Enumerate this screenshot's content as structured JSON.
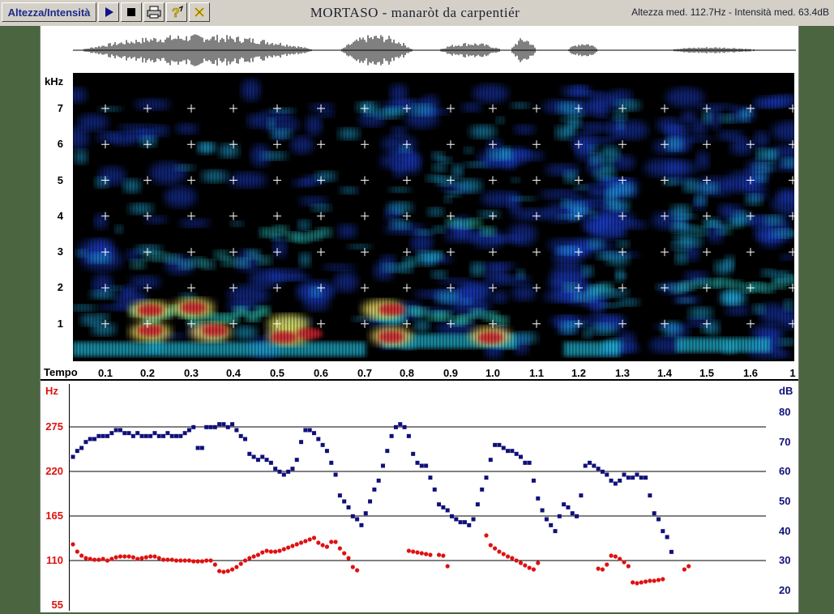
{
  "toolbar": {
    "mode_button": "Altezza/Intensità",
    "icons": [
      "play-icon",
      "stop-icon",
      "print-icon",
      "help-icon",
      "close-icon"
    ]
  },
  "title": "MORTASO  -  manaròt da carpentiér",
  "stats": "Altezza med. 112.7Hz - Intensità med. 63.4dB",
  "spectrogram": {
    "y_unit": "kHz",
    "y_ticks": [
      "7",
      "6",
      "5",
      "4",
      "3",
      "2",
      "1"
    ],
    "x_label": "Tempo",
    "x_ticks": [
      "0.1",
      "0.2",
      "0.3",
      "0.4",
      "0.5",
      "0.6",
      "0.7",
      "0.8",
      "0.9",
      "1.0",
      "1.1",
      "1.2",
      "1.3",
      "1.4",
      "1.5",
      "1.6",
      "1"
    ]
  },
  "pitch_plot": {
    "left_unit": "Hz",
    "left_ticks": [
      "275",
      "220",
      "165",
      "110",
      "55"
    ],
    "right_unit": "dB",
    "right_ticks": [
      "80",
      "70",
      "60",
      "50",
      "40",
      "30",
      "20"
    ],
    "colors": {
      "pitch": "#e01010",
      "intensity": "#10107a",
      "left_axis": "#e01010",
      "right_axis": "#10107a"
    }
  },
  "chart_data": {
    "type": "scatter",
    "x_unit": "s",
    "series": [
      {
        "axis": "Hz",
        "points": [
          [
            0.08,
            130
          ],
          [
            0.09,
            121
          ],
          [
            0.1,
            116
          ],
          [
            0.11,
            113
          ],
          [
            0.12,
            112
          ],
          [
            0.13,
            111
          ],
          [
            0.14,
            111
          ],
          [
            0.15,
            112
          ],
          [
            0.16,
            110
          ],
          [
            0.17,
            112
          ],
          [
            0.18,
            114
          ],
          [
            0.19,
            115
          ],
          [
            0.2,
            115
          ],
          [
            0.21,
            115
          ],
          [
            0.22,
            114
          ],
          [
            0.23,
            112
          ],
          [
            0.24,
            113
          ],
          [
            0.25,
            114
          ],
          [
            0.26,
            115
          ],
          [
            0.27,
            115
          ],
          [
            0.28,
            113
          ],
          [
            0.29,
            111
          ],
          [
            0.3,
            111
          ],
          [
            0.31,
            111
          ],
          [
            0.32,
            110
          ],
          [
            0.33,
            110
          ],
          [
            0.34,
            110
          ],
          [
            0.35,
            110
          ],
          [
            0.36,
            109
          ],
          [
            0.37,
            109
          ],
          [
            0.38,
            109
          ],
          [
            0.39,
            110
          ],
          [
            0.4,
            110
          ],
          [
            0.41,
            105
          ],
          [
            0.42,
            97
          ],
          [
            0.43,
            96
          ],
          [
            0.44,
            97
          ],
          [
            0.45,
            99
          ],
          [
            0.46,
            102
          ],
          [
            0.47,
            106
          ],
          [
            0.48,
            110
          ],
          [
            0.49,
            113
          ],
          [
            0.5,
            115
          ],
          [
            0.51,
            117
          ],
          [
            0.52,
            120
          ],
          [
            0.53,
            122
          ],
          [
            0.54,
            121
          ],
          [
            0.55,
            121
          ],
          [
            0.56,
            122
          ],
          [
            0.57,
            124
          ],
          [
            0.58,
            126
          ],
          [
            0.59,
            128
          ],
          [
            0.6,
            130
          ],
          [
            0.61,
            132
          ],
          [
            0.62,
            134
          ],
          [
            0.63,
            136
          ],
          [
            0.64,
            138
          ],
          [
            0.65,
            132
          ],
          [
            0.66,
            129
          ],
          [
            0.67,
            127
          ],
          [
            0.68,
            133
          ],
          [
            0.69,
            133
          ],
          [
            0.7,
            125
          ],
          [
            0.71,
            119
          ],
          [
            0.72,
            113
          ],
          [
            0.73,
            102
          ],
          [
            0.74,
            98
          ],
          [
            0.86,
            122
          ],
          [
            0.87,
            121
          ],
          [
            0.88,
            120
          ],
          [
            0.89,
            119
          ],
          [
            0.9,
            118
          ],
          [
            0.91,
            117
          ],
          [
            0.93,
            117
          ],
          [
            0.94,
            116
          ],
          [
            0.95,
            103
          ],
          [
            1.04,
            141
          ],
          [
            1.05,
            129
          ],
          [
            1.06,
            125
          ],
          [
            1.07,
            121
          ],
          [
            1.08,
            118
          ],
          [
            1.09,
            115
          ],
          [
            1.1,
            113
          ],
          [
            1.11,
            110
          ],
          [
            1.12,
            107
          ],
          [
            1.13,
            104
          ],
          [
            1.14,
            101
          ],
          [
            1.15,
            99
          ],
          [
            1.16,
            107
          ],
          [
            1.3,
            100
          ],
          [
            1.31,
            99
          ],
          [
            1.32,
            105
          ],
          [
            1.33,
            116
          ],
          [
            1.34,
            115
          ],
          [
            1.35,
            112
          ],
          [
            1.36,
            108
          ],
          [
            1.37,
            103
          ],
          [
            1.38,
            83
          ],
          [
            1.39,
            82
          ],
          [
            1.4,
            83
          ],
          [
            1.41,
            84
          ],
          [
            1.42,
            85
          ],
          [
            1.43,
            85
          ],
          [
            1.44,
            86
          ],
          [
            1.45,
            87
          ],
          [
            1.5,
            99
          ],
          [
            1.51,
            103
          ]
        ]
      },
      {
        "axis": "dB",
        "points": [
          [
            0.08,
            65
          ],
          [
            0.09,
            67
          ],
          [
            0.1,
            68
          ],
          [
            0.11,
            70
          ],
          [
            0.12,
            71
          ],
          [
            0.13,
            71
          ],
          [
            0.14,
            72
          ],
          [
            0.15,
            72
          ],
          [
            0.16,
            72
          ],
          [
            0.17,
            73
          ],
          [
            0.18,
            74
          ],
          [
            0.19,
            74
          ],
          [
            0.2,
            73
          ],
          [
            0.21,
            73
          ],
          [
            0.22,
            72
          ],
          [
            0.23,
            73
          ],
          [
            0.24,
            72
          ],
          [
            0.25,
            72
          ],
          [
            0.26,
            72
          ],
          [
            0.27,
            73
          ],
          [
            0.28,
            72
          ],
          [
            0.29,
            72
          ],
          [
            0.3,
            73
          ],
          [
            0.31,
            72
          ],
          [
            0.32,
            72
          ],
          [
            0.33,
            72
          ],
          [
            0.34,
            73
          ],
          [
            0.35,
            74
          ],
          [
            0.36,
            75
          ],
          [
            0.37,
            68
          ],
          [
            0.38,
            68
          ],
          [
            0.39,
            75
          ],
          [
            0.4,
            75
          ],
          [
            0.41,
            75
          ],
          [
            0.42,
            76
          ],
          [
            0.43,
            76
          ],
          [
            0.44,
            75
          ],
          [
            0.45,
            76
          ],
          [
            0.46,
            74
          ],
          [
            0.47,
            72
          ],
          [
            0.48,
            71
          ],
          [
            0.49,
            66
          ],
          [
            0.5,
            65
          ],
          [
            0.51,
            64
          ],
          [
            0.52,
            65
          ],
          [
            0.53,
            64
          ],
          [
            0.54,
            63
          ],
          [
            0.55,
            61
          ],
          [
            0.56,
            60
          ],
          [
            0.57,
            59
          ],
          [
            0.58,
            60
          ],
          [
            0.59,
            61
          ],
          [
            0.6,
            64
          ],
          [
            0.61,
            70
          ],
          [
            0.62,
            74
          ],
          [
            0.63,
            74
          ],
          [
            0.64,
            73
          ],
          [
            0.65,
            71
          ],
          [
            0.66,
            69
          ],
          [
            0.67,
            67
          ],
          [
            0.68,
            63
          ],
          [
            0.69,
            59
          ],
          [
            0.7,
            52
          ],
          [
            0.71,
            50
          ],
          [
            0.72,
            48
          ],
          [
            0.73,
            45
          ],
          [
            0.74,
            44
          ],
          [
            0.75,
            42
          ],
          [
            0.76,
            46
          ],
          [
            0.77,
            50
          ],
          [
            0.78,
            54
          ],
          [
            0.79,
            57
          ],
          [
            0.8,
            62
          ],
          [
            0.81,
            67
          ],
          [
            0.82,
            72
          ],
          [
            0.83,
            75
          ],
          [
            0.84,
            76
          ],
          [
            0.85,
            75
          ],
          [
            0.86,
            72
          ],
          [
            0.87,
            66
          ],
          [
            0.88,
            63
          ],
          [
            0.89,
            62
          ],
          [
            0.9,
            62
          ],
          [
            0.91,
            58
          ],
          [
            0.92,
            54
          ],
          [
            0.93,
            49
          ],
          [
            0.94,
            48
          ],
          [
            0.95,
            47
          ],
          [
            0.96,
            45
          ],
          [
            0.97,
            44
          ],
          [
            0.98,
            43
          ],
          [
            0.99,
            43
          ],
          [
            1.0,
            42
          ],
          [
            1.01,
            44
          ],
          [
            1.02,
            49
          ],
          [
            1.03,
            54
          ],
          [
            1.04,
            58
          ],
          [
            1.05,
            64
          ],
          [
            1.06,
            69
          ],
          [
            1.07,
            69
          ],
          [
            1.08,
            68
          ],
          [
            1.09,
            67
          ],
          [
            1.1,
            67
          ],
          [
            1.11,
            66
          ],
          [
            1.12,
            65
          ],
          [
            1.13,
            63
          ],
          [
            1.14,
            63
          ],
          [
            1.15,
            57
          ],
          [
            1.16,
            51
          ],
          [
            1.17,
            47
          ],
          [
            1.18,
            44
          ],
          [
            1.19,
            42
          ],
          [
            1.2,
            40
          ],
          [
            1.21,
            45
          ],
          [
            1.22,
            49
          ],
          [
            1.23,
            48
          ],
          [
            1.24,
            46
          ],
          [
            1.25,
            45
          ],
          [
            1.26,
            52
          ],
          [
            1.27,
            62
          ],
          [
            1.28,
            63
          ],
          [
            1.29,
            62
          ],
          [
            1.3,
            61
          ],
          [
            1.31,
            60
          ],
          [
            1.32,
            59
          ],
          [
            1.33,
            57
          ],
          [
            1.34,
            56
          ],
          [
            1.35,
            57
          ],
          [
            1.36,
            59
          ],
          [
            1.37,
            58
          ],
          [
            1.38,
            58
          ],
          [
            1.39,
            59
          ],
          [
            1.4,
            58
          ],
          [
            1.41,
            58
          ],
          [
            1.42,
            52
          ],
          [
            1.43,
            46
          ],
          [
            1.44,
            44
          ],
          [
            1.45,
            40
          ],
          [
            1.46,
            38
          ],
          [
            1.47,
            33
          ]
        ]
      }
    ]
  }
}
